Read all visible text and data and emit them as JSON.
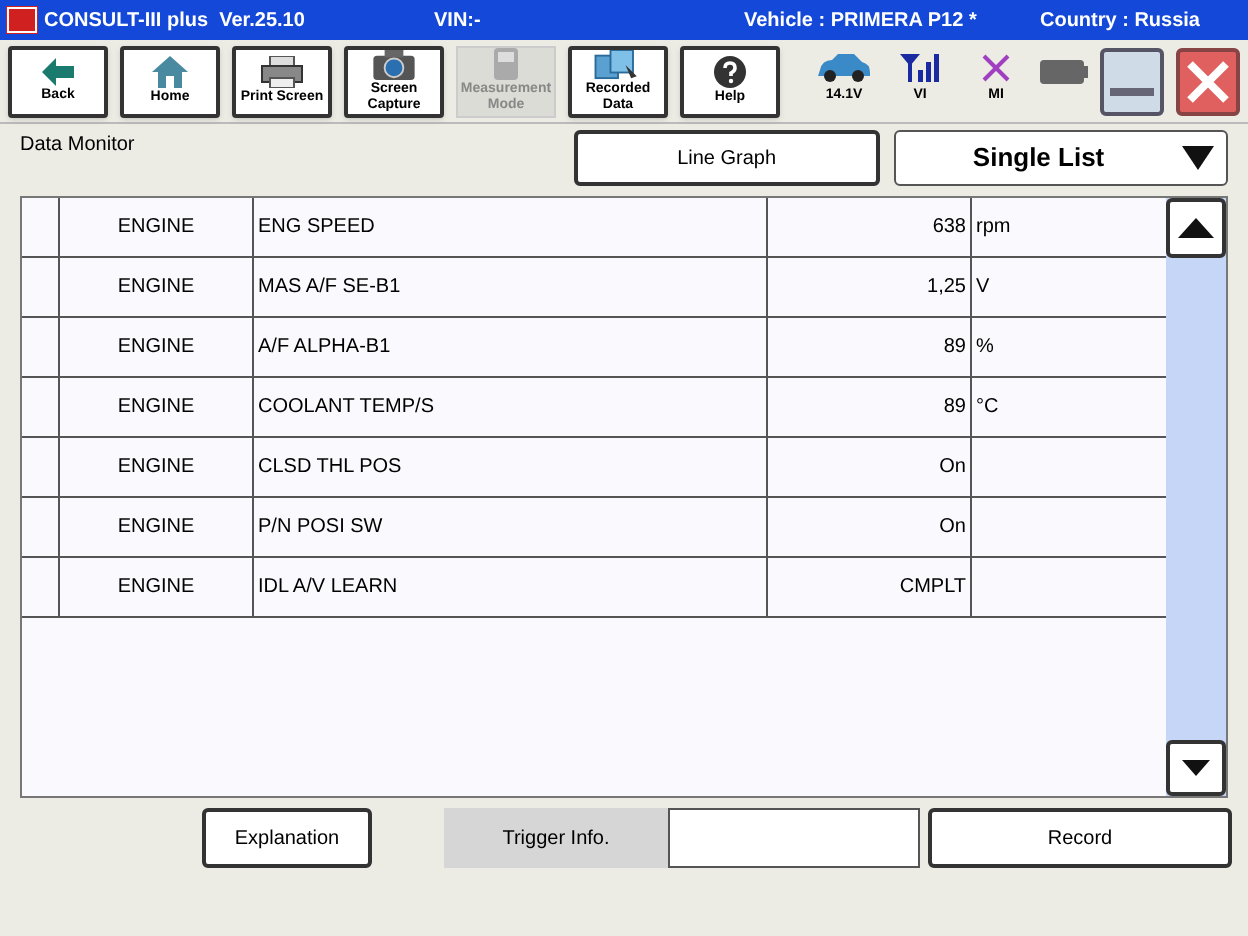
{
  "title_bar": {
    "app": "CONSULT-III plus  Ver.25.10",
    "vin": "VIN:-",
    "vehicle": "Vehicle : PRIMERA P12 *",
    "country": "Country : Russia"
  },
  "toolbar": [
    {
      "label": "Back",
      "kind": "back",
      "disabled": false
    },
    {
      "label": "Home",
      "kind": "home",
      "disabled": false
    },
    {
      "label": "Print Screen",
      "kind": "print",
      "disabled": false
    },
    {
      "label": "Screen Capture",
      "kind": "camera",
      "disabled": false
    },
    {
      "label": "Measurement Mode",
      "kind": "measure",
      "disabled": true
    },
    {
      "label": "Recorded Data",
      "kind": "recorded",
      "disabled": false
    },
    {
      "label": "Help",
      "kind": "help",
      "disabled": false
    }
  ],
  "status": [
    {
      "label": "14.1V",
      "kind": "car"
    },
    {
      "label": "VI",
      "kind": "signal"
    },
    {
      "label": "MI",
      "kind": "cross"
    }
  ],
  "section_title": "Data Monitor",
  "line_graph_button": "Line Graph",
  "view_select": "Single List",
  "rows": [
    {
      "system": "ENGINE",
      "item": "ENG SPEED",
      "value": "638",
      "unit": "rpm"
    },
    {
      "system": "ENGINE",
      "item": "MAS A/F SE-B1",
      "value": "1,25",
      "unit": "V"
    },
    {
      "system": "ENGINE",
      "item": "A/F ALPHA-B1",
      "value": "89",
      "unit": "%"
    },
    {
      "system": "ENGINE",
      "item": "COOLANT TEMP/S",
      "value": "89",
      "unit": "°C"
    },
    {
      "system": "ENGINE",
      "item": "CLSD THL POS",
      "value": "On"
    },
    {
      "system": "ENGINE",
      "item": "P/N POSI SW",
      "value": "On"
    },
    {
      "system": "ENGINE",
      "item": "IDL A/V LEARN",
      "value": "CMPLT"
    }
  ],
  "bottom": {
    "explanation": "Explanation",
    "trigger": "Trigger Info.",
    "record": "Record"
  }
}
